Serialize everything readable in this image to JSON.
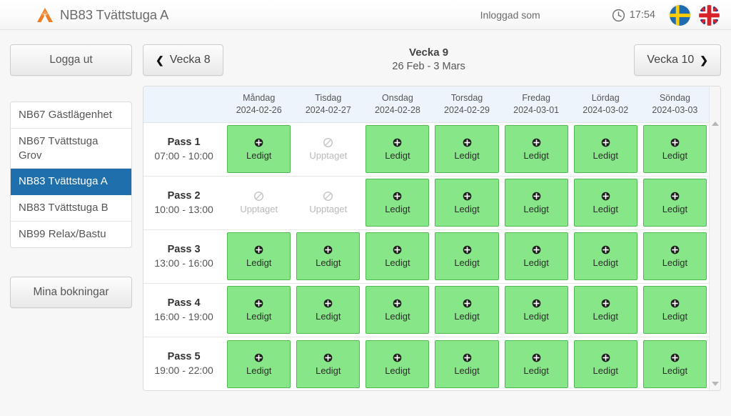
{
  "topbar": {
    "logo_icon": "mountain-logo-icon",
    "title": "NB83 Tvättstuga A",
    "logged_in_as_label": "Inloggad som",
    "logged_in_as_value": "",
    "clock_icon": "clock-icon",
    "time": "17:54",
    "flag_se": "swedish-flag-icon",
    "flag_gb": "british-flag-icon",
    "colors": {
      "brand_orange": "#ef7d22",
      "title_gray": "#6b6b6b"
    }
  },
  "sidebar": {
    "logout_label": "Logga ut",
    "my_bookings_label": "Mina bokningar",
    "items": [
      {
        "label": "NB67 Gästlägenhet",
        "active": false
      },
      {
        "label": "NB67 Tvättstuga Grov",
        "active": false
      },
      {
        "label": "NB83 Tvättstuga A",
        "active": true
      },
      {
        "label": "NB83 Tvättstuga B",
        "active": false
      },
      {
        "label": "NB99 Relax/Bastu",
        "active": false
      }
    ],
    "active_color": "#1f6fad"
  },
  "weeknav": {
    "prev_label": "Vecka 8",
    "prev_icon": "chevron-left-icon",
    "next_label": "Vecka 10",
    "next_icon": "chevron-right-icon",
    "current_week": "Vecka 9",
    "date_range": "26 Feb - 3 Mars"
  },
  "schedule": {
    "label_column_header": "",
    "free_text": "Ledigt",
    "busy_text": "Upptaget",
    "free_icon": "plus-circle-icon",
    "busy_icon": "no-entry-icon",
    "free_color": "#87e687",
    "days": [
      {
        "name": "Måndag",
        "date": "2024-02-26"
      },
      {
        "name": "Tisdag",
        "date": "2024-02-27"
      },
      {
        "name": "Onsdag",
        "date": "2024-02-28"
      },
      {
        "name": "Torsdag",
        "date": "2024-02-29"
      },
      {
        "name": "Fredag",
        "date": "2024-03-01"
      },
      {
        "name": "Lördag",
        "date": "2024-03-02"
      },
      {
        "name": "Söndag",
        "date": "2024-03-03"
      }
    ],
    "rows": [
      {
        "pass": "Pass 1",
        "time": "07:00 - 10:00",
        "slots": [
          "free",
          "busy",
          "free",
          "free",
          "free",
          "free",
          "free"
        ]
      },
      {
        "pass": "Pass 2",
        "time": "10:00 - 13:00",
        "slots": [
          "busy",
          "busy",
          "free",
          "free",
          "free",
          "free",
          "free"
        ]
      },
      {
        "pass": "Pass 3",
        "time": "13:00 - 16:00",
        "slots": [
          "free",
          "free",
          "free",
          "free",
          "free",
          "free",
          "free"
        ]
      },
      {
        "pass": "Pass 4",
        "time": "16:00 - 19:00",
        "slots": [
          "free",
          "free",
          "free",
          "free",
          "free",
          "free",
          "free"
        ]
      },
      {
        "pass": "Pass 5",
        "time": "19:00 - 22:00",
        "slots": [
          "free",
          "free",
          "free",
          "free",
          "free",
          "free",
          "free"
        ]
      }
    ]
  },
  "scrollbar": {
    "up_icon": "scroll-up-arrow-icon",
    "down_icon": "scroll-down-arrow-icon"
  }
}
